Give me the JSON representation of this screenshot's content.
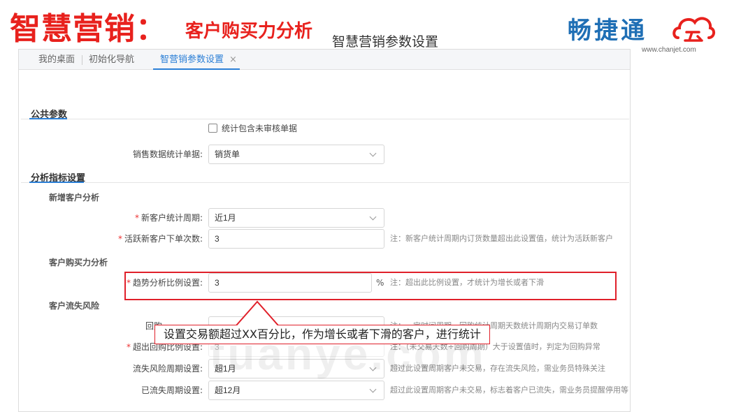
{
  "slide": {
    "title": "智慧营销：",
    "subtitle": "客户购买力分析"
  },
  "brand": {
    "name": "畅捷通",
    "url": "www.chanjet.com",
    "accent": "#1f6fb5",
    "logo_color": "#e8211d"
  },
  "tabs": [
    {
      "label": "我的桌面"
    },
    {
      "label": "初始化导航"
    },
    {
      "label": "智营销参数设置",
      "close": "×"
    }
  ],
  "page": {
    "title": "智慧营销参数设置"
  },
  "public_params": {
    "title": "公共参数",
    "include_unaudited": {
      "label": "统计包含未审核单据",
      "checked": false
    },
    "sales_doc": {
      "label": "销售数据统计单据:",
      "value": "销货单"
    }
  },
  "analysis": {
    "title": "分析指标设置",
    "new_customer": {
      "title": "新增客户分析",
      "period": {
        "label": "新客户统计周期:",
        "value": "近1月"
      },
      "active_orders": {
        "label": "活跃新客户下单次数:",
        "value": "3",
        "note": "注：新客户统计周期内订货数量超出此设置值，统计为活跃新客户"
      }
    },
    "purchasing_power": {
      "title": "客户购买力分析",
      "trend_ratio": {
        "label": "趋势分析比例设置:",
        "value": "3",
        "unit": "%",
        "note": "注：超出此比例设置，才统计为增长或者下滑"
      }
    },
    "churn": {
      "title": "客户流失风险",
      "repurchase_period": {
        "label": "回购",
        "note": "注：一定时间周期，回购统计周期天数统计周期内交易订单数"
      },
      "repurchase_ratio": {
        "label": "超出回购比例设置:",
        "value": "3",
        "note": "注：（未交易天数÷回购周期）大于设置值时，判定为回购异常"
      },
      "risk_period": {
        "label": "流失风险周期设置:",
        "value": "超1月",
        "note": "超过此设置周期客户未交易，存在流失风险，需业务员特殊关注"
      },
      "lost_period": {
        "label": "已流失周期设置:",
        "value": "超12月",
        "note": "超过此设置周期客户未交易，标志着客户已流失，需业务员提醒停用等"
      }
    }
  },
  "callout": {
    "text": "设置交易额超过XX百分比，作为增长或者下滑的客户，进行统计"
  },
  "watermark": "tuanye.com"
}
